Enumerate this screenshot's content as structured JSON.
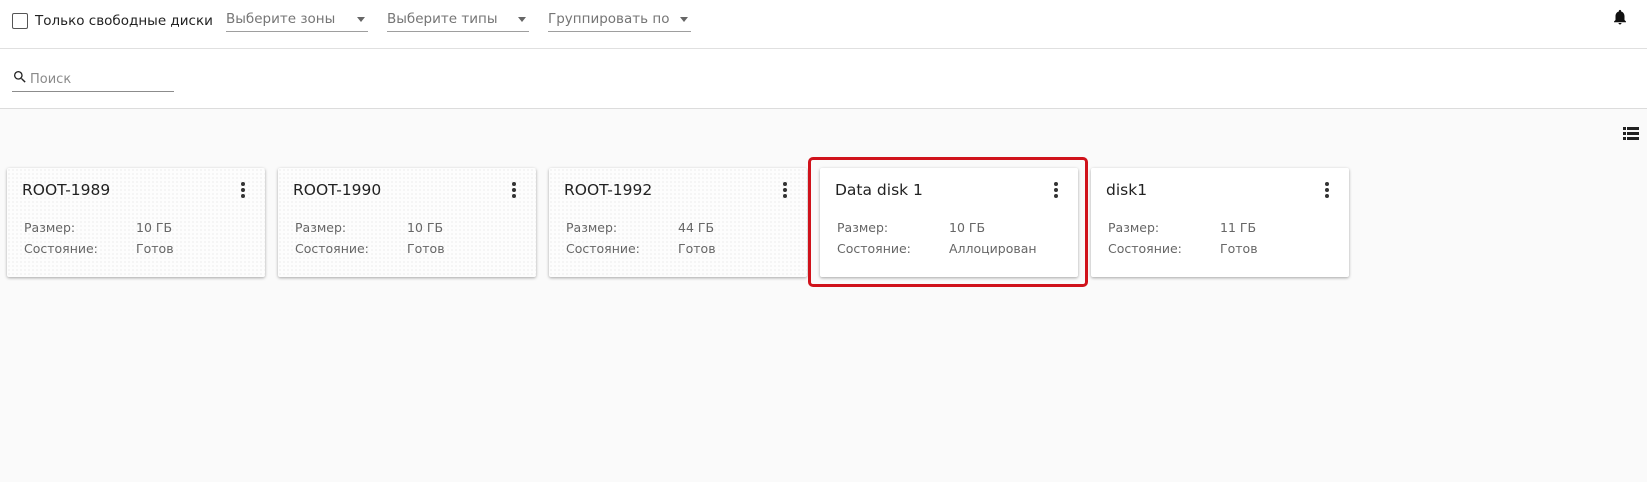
{
  "filters": {
    "free_disks_label": "Только свободные диски",
    "free_disks_checked": false,
    "zones_placeholder": "Выберите зоны",
    "types_placeholder": "Выберите типы",
    "group_by_placeholder": "Группировать по"
  },
  "search": {
    "placeholder": "Поиск",
    "value": ""
  },
  "labels": {
    "size": "Размер:",
    "state": "Состояние:"
  },
  "disks": [
    {
      "name": "ROOT-1989",
      "size": "10 ГБ",
      "state": "Готов"
    },
    {
      "name": "ROOT-1990",
      "size": "10 ГБ",
      "state": "Готов"
    },
    {
      "name": "ROOT-1992",
      "size": "44 ГБ",
      "state": "Готов"
    },
    {
      "name": "Data disk 1",
      "size": "10 ГБ",
      "state": "Аллоцирован",
      "highlighted": true
    },
    {
      "name": "disk1",
      "size": "11 ГБ",
      "state": "Готов"
    }
  ],
  "icons": {
    "notifications": "bell-icon",
    "view_toggle": "list-view-icon",
    "search": "search-icon",
    "card_menu": "more-vert-icon"
  },
  "colors": {
    "highlight": "#d0121b",
    "background": "#fafafa"
  }
}
